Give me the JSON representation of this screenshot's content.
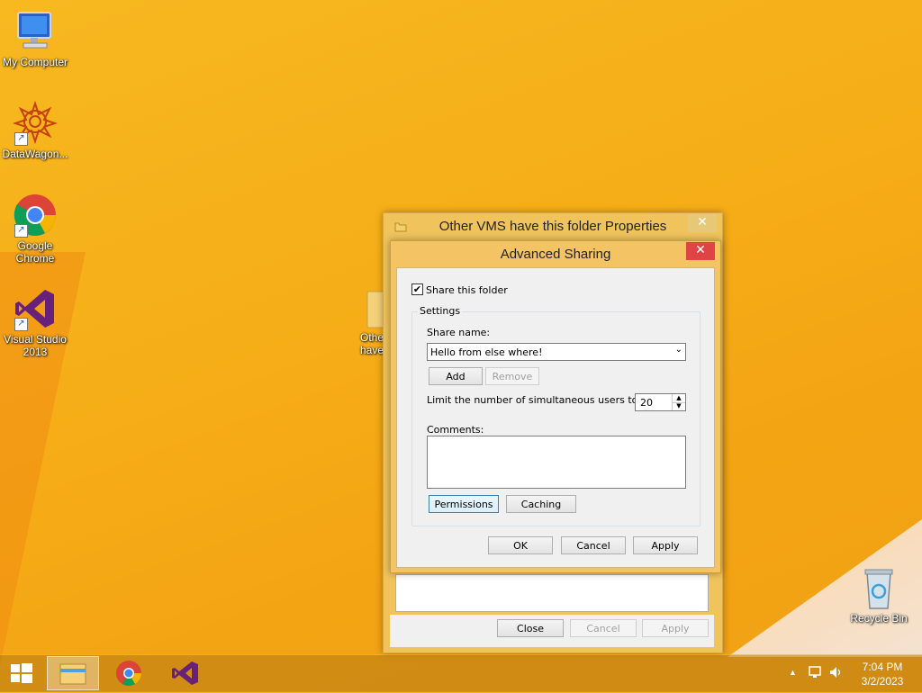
{
  "desktop": {
    "icons": [
      {
        "label": "My Computer"
      },
      {
        "label": "DataWagon..."
      },
      {
        "label": "Google Chrome"
      },
      {
        "label": "Visual Studio 2013"
      },
      {
        "label": "Recycle Bin"
      }
    ],
    "partial_folder": {
      "line1": "Othe",
      "line2": "have"
    }
  },
  "properties_window": {
    "title": "Other VMS have this folder Properties",
    "close_label": "Close",
    "cancel_label": "Cancel",
    "apply_label": "Apply"
  },
  "advanced_sharing": {
    "title": "Advanced Sharing",
    "share_checkbox_label": "Share this folder",
    "share_checked": true,
    "settings_legend": "Settings",
    "share_name_label": "Share name:",
    "share_name_value": "Hello from else where!",
    "add_label": "Add",
    "remove_label": "Remove",
    "limit_label": "Limit the number of simultaneous users to:",
    "limit_value": "20",
    "comments_label": "Comments:",
    "comments_value": "",
    "permissions_label": "Permissions",
    "caching_label": "Caching",
    "ok_label": "OK",
    "cancel_label": "Cancel",
    "apply_label": "Apply"
  },
  "taskbar": {
    "time": "7:04 PM",
    "date": "3/2/2023"
  },
  "colors": {
    "desktop": "#f6ad17",
    "window_frame": "#f0c35d",
    "close_button": "#e04343"
  }
}
